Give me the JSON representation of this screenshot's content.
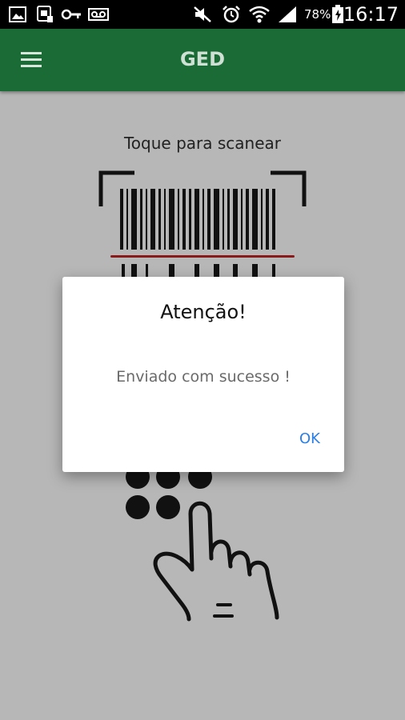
{
  "status_bar": {
    "icons": [
      "image-icon",
      "sim-icon",
      "key-icon",
      "voicemail-icon",
      "mute-icon",
      "alarm-icon",
      "wifi-icon",
      "signal-icon",
      "battery-icon"
    ],
    "battery": "78%",
    "time": "16:17"
  },
  "app_bar": {
    "title": "GED",
    "menu_icon": "hamburger-menu-icon"
  },
  "main": {
    "scan_hint": "Toque para scanear",
    "scan_icon": "barcode-scan-icon",
    "hand_icon": "hand-tap-icon"
  },
  "dialog": {
    "title": "Atenção!",
    "message": "Enviado com sucesso !",
    "ok_label": "OK"
  },
  "colors": {
    "app_bar": "#1a6b35",
    "background": "#b7b7b7",
    "accent": "#2a7ee8",
    "scan_line": "#8a1a1a"
  }
}
